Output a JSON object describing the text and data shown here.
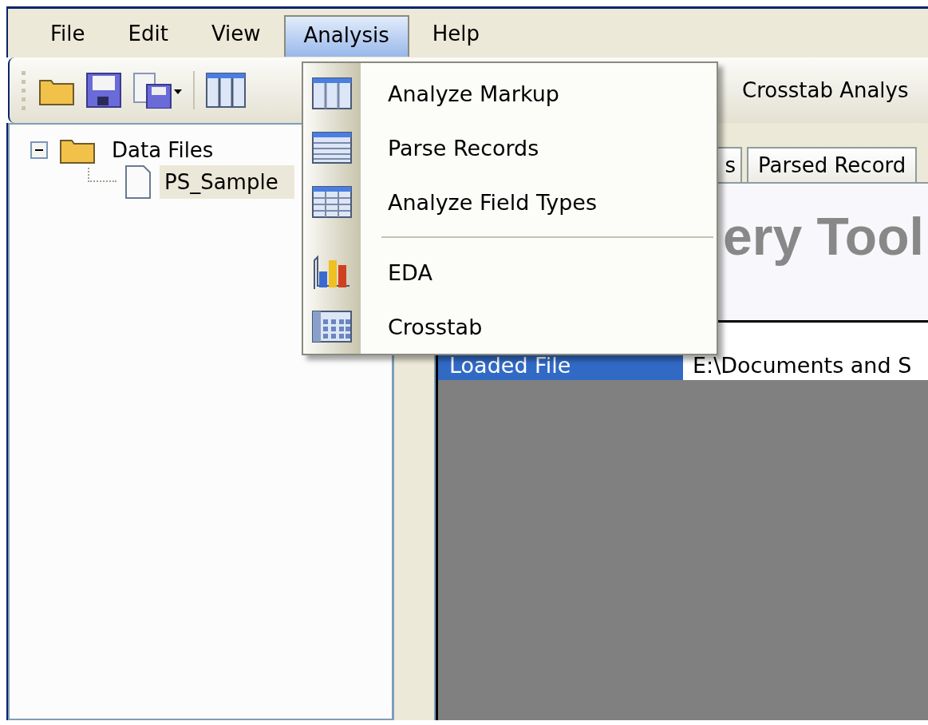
{
  "menu_bar": [
    {
      "label": "File",
      "selected": false
    },
    {
      "label": "Edit",
      "selected": false
    },
    {
      "label": "View",
      "selected": false
    },
    {
      "label": "Analysis",
      "selected": true
    },
    {
      "label": "Help",
      "selected": false
    }
  ],
  "analysis_menu": {
    "groups": [
      [
        {
          "label": "Analyze Markup"
        },
        {
          "label": "Parse Records"
        },
        {
          "label": "Analyze Field Types"
        }
      ],
      [
        {
          "label": "EDA"
        },
        {
          "label": "Crosstab"
        }
      ]
    ]
  },
  "toolbar": {
    "crosstab_button": "Crosstab Analys"
  },
  "tree": [
    {
      "label": "Data Files",
      "expanded": true,
      "children": [
        {
          "label": "PS_Sample",
          "selected": true
        }
      ]
    }
  ],
  "tabs": [
    {
      "label": "s"
    },
    {
      "label": "Parsed Record"
    }
  ],
  "title": "ery Tool",
  "info_rows": [
    {
      "label": "Loaded File",
      "value": "E:\\Documents and S"
    }
  ]
}
